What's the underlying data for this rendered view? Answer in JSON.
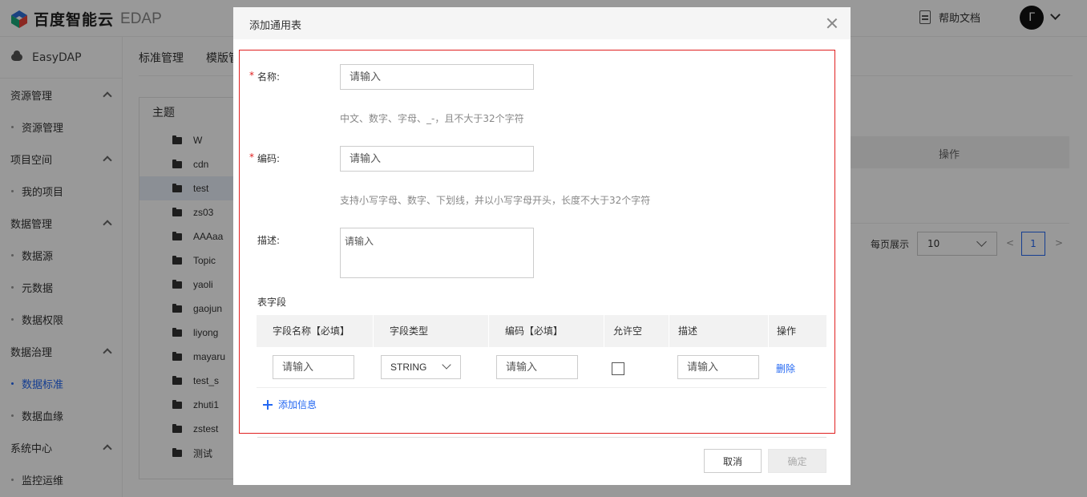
{
  "header": {
    "brand": "百度智能云",
    "product": "EDAP",
    "help_label": "帮助文档",
    "avatar_letter": "Γ"
  },
  "sidebar": {
    "app_name": "EasyDAP",
    "groups": [
      {
        "label": "资源管理",
        "items": [
          "资源管理"
        ]
      },
      {
        "label": "项目空间",
        "items": [
          "我的项目"
        ]
      },
      {
        "label": "数据管理",
        "items": [
          "数据源",
          "元数据",
          "数据权限"
        ]
      },
      {
        "label": "数据治理",
        "items": [
          "数据标准",
          "数据血缘"
        ]
      },
      {
        "label": "系统中心",
        "items": [
          "监控运维"
        ]
      }
    ],
    "active_item": "数据标准"
  },
  "main": {
    "tabs": [
      "标准管理",
      "模版管"
    ],
    "topic_header": "主题",
    "topics": [
      "W",
      "cdn",
      "test",
      "zs03",
      "AAAaa",
      "Topic",
      "yaoli",
      "gaojun",
      "liyong",
      "mayaru",
      "test_s",
      "zhuti1",
      "zstest",
      "测试"
    ],
    "selected_topic": "test",
    "op_column": "操作",
    "pager": {
      "label": "每页展示",
      "page_size": "10",
      "prev": "<",
      "page": "1",
      "next": ">"
    }
  },
  "modal": {
    "title": "添加通用表",
    "required_mark": "*",
    "name": {
      "label": "名称:",
      "placeholder": "请输入",
      "hint": "中文、数字、字母、_-，且不大于32个字符"
    },
    "code": {
      "label": "编码:",
      "placeholder": "请输入",
      "hint": "支持小写字母、数字、下划线，并以小写字母开头，长度不大于32个字符"
    },
    "desc": {
      "label": "描述:",
      "placeholder": "请输入"
    },
    "fields_label": "表字段",
    "table": {
      "headers": [
        "字段名称【必填】",
        "字段类型",
        "编码【必填】",
        "允许空",
        "描述",
        "操作"
      ],
      "row": {
        "name_placeholder": "请输入",
        "type_value": "STRING",
        "code_placeholder": "请输入",
        "nullable": false,
        "desc_placeholder": "请输入",
        "delete_label": "删除"
      }
    },
    "add_label": "添加信息",
    "cancel_label": "取消",
    "ok_label": "确定"
  },
  "colors": {
    "accent": "#2468f2",
    "required": "#e02020",
    "overlay": "rgba(0,0,0,0.4)"
  }
}
